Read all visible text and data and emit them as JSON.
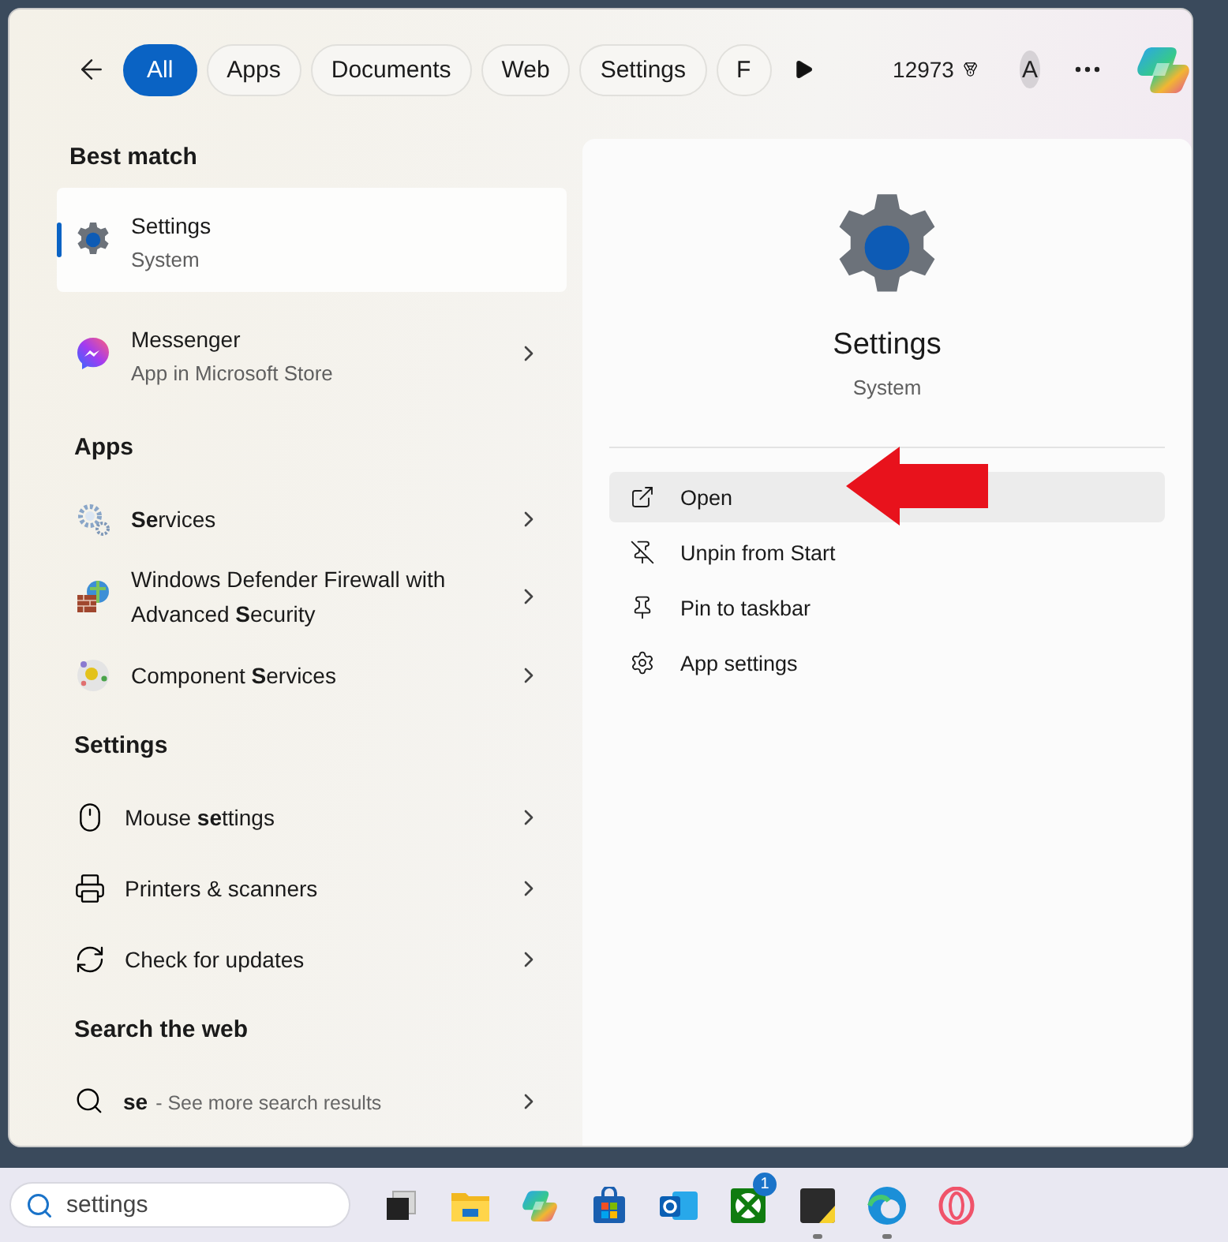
{
  "filters": [
    {
      "label": "All",
      "selected": true
    },
    {
      "label": "Apps",
      "selected": false
    },
    {
      "label": "Documents",
      "selected": false
    },
    {
      "label": "Web",
      "selected": false
    },
    {
      "label": "Settings",
      "selected": false
    },
    {
      "label": "F",
      "selected": false
    }
  ],
  "points": "12973",
  "account_initial": "A",
  "sections": [
    {
      "heading": "Best match",
      "items": [
        {
          "kind": "gear",
          "title": "Settings",
          "subtitle": "System",
          "selected": true
        }
      ]
    },
    {
      "items": [
        {
          "kind": "messenger",
          "title": "Messenger",
          "subtitle": "App in Microsoft Store",
          "selected": false
        }
      ]
    },
    {
      "heading": "Apps",
      "items": [
        {
          "kind": "services",
          "title": "**Se**rvices",
          "selected": false
        },
        {
          "kind": "firewall",
          "title": "Windows Defender Firewall with Advanced **S**ecurity",
          "selected": false
        },
        {
          "kind": "component",
          "title": "Component **S**ervices",
          "selected": false
        }
      ]
    },
    {
      "heading": "Settings",
      "items": [
        {
          "kind": "mouse",
          "title": "Mouse **se**ttings",
          "selected": false
        },
        {
          "kind": "printer",
          "title": "Printers & scanners",
          "selected": false
        },
        {
          "kind": "refresh",
          "title": "Check for updates",
          "selected": false
        }
      ]
    },
    {
      "heading": "Search the web",
      "items": [
        {
          "kind": "search",
          "title": "**se**",
          "hint": "- See more search results",
          "selected": false
        }
      ]
    }
  ],
  "detail": {
    "title": "Settings",
    "subtitle": "System",
    "actions": [
      {
        "kind": "open",
        "label": "Open",
        "selected": true
      },
      {
        "kind": "unpin",
        "label": "Unpin from Start",
        "selected": false
      },
      {
        "kind": "pin",
        "label": "Pin to taskbar",
        "selected": false
      },
      {
        "kind": "gear",
        "label": "App settings",
        "selected": false
      }
    ]
  },
  "taskbar": {
    "search_value": "settings",
    "apps": [
      {
        "kind": "taskview",
        "running": false
      },
      {
        "kind": "folder",
        "running": false
      },
      {
        "kind": "copilot",
        "running": false
      },
      {
        "kind": "store",
        "running": false
      },
      {
        "kind": "outlook",
        "running": false
      },
      {
        "kind": "xbox",
        "running": false,
        "badge": "1"
      },
      {
        "kind": "sticky",
        "running": true
      },
      {
        "kind": "edge",
        "running": true
      },
      {
        "kind": "opera",
        "running": false
      }
    ]
  }
}
